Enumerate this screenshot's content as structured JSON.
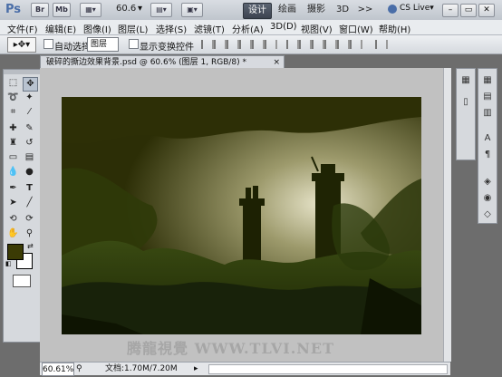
{
  "app": {
    "logo": "Ps",
    "launch_br": "Br",
    "launch_mb": "Mb",
    "zoom": "60.6",
    "cs_live": "CS Live▾"
  },
  "workspaces": [
    "设计",
    "绘画",
    "摄影",
    "3D",
    ">>"
  ],
  "window_controls": {
    "min": "–",
    "restore": "▭",
    "close": "✕"
  },
  "menu": [
    "文件(F)",
    "编辑(E)",
    "图像(I)",
    "图层(L)",
    "选择(S)",
    "滤镜(T)",
    "分析(A)",
    "3D(D)",
    "视图(V)",
    "窗口(W)",
    "帮助(H)"
  ],
  "options": {
    "auto_select": "自动选择:",
    "layer_select": "图层",
    "show_transform": "显示变换控件"
  },
  "document": {
    "tab_title": "破碎的撕边效果背景.psd @ 60.6% (图层 1, RGB/8) *",
    "tab_close": "×"
  },
  "status": {
    "zoom": "60.61%",
    "doc_size": "文档:1.70M/7.20M"
  },
  "watermark": "腾龍視覺 WWW.TLVI.NET",
  "tools": [
    "marquee-icon",
    "move-icon",
    "lasso-icon",
    "magic-wand-icon",
    "crop-icon",
    "eyedropper-icon",
    "healing-icon",
    "brush-icon",
    "stamp-icon",
    "history-brush-icon",
    "eraser-icon",
    "gradient-icon",
    "blur-icon",
    "dodge-icon",
    "pen-icon",
    "type-icon",
    "path-select-icon",
    "shape-icon",
    "3d-rotate-icon",
    "3d-orbit-icon",
    "hand-icon",
    "zoom-icon"
  ],
  "colors": {
    "foreground": "#3b3b05",
    "background": "#ffffff",
    "accent": "#4a6ea8"
  }
}
